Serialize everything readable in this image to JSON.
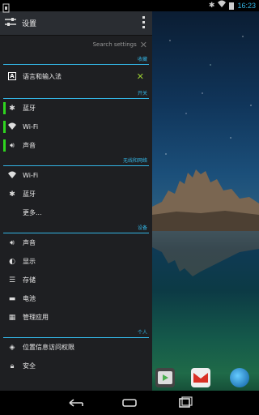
{
  "status_bar": {
    "time": "16:23",
    "icons": [
      "notification-icon",
      "bluetooth-icon",
      "wifi-icon",
      "battery-icon"
    ]
  },
  "action_bar": {
    "title": "设置",
    "icon": "settings-tune-icon",
    "overflow": "overflow-menu-icon"
  },
  "search": {
    "placeholder": "Search settings"
  },
  "sections": [
    {
      "key": "favorites",
      "header": "收藏",
      "items": [
        {
          "label": "语言和输入法",
          "icon": "keyboard-a-icon",
          "extra": "✕"
        }
      ]
    },
    {
      "key": "toggles",
      "header": "开关",
      "items": [
        {
          "label": "蓝牙",
          "icon": "bluetooth-icon",
          "selected": true
        },
        {
          "label": "Wi-Fi",
          "icon": "wifi-icon",
          "selected": true
        },
        {
          "label": "声音",
          "icon": "sound-icon",
          "selected": true
        }
      ]
    },
    {
      "key": "wireless",
      "header": "无线和网络",
      "items": [
        {
          "label": "Wi-Fi",
          "icon": "wifi-icon"
        },
        {
          "label": "蓝牙",
          "icon": "bluetooth-icon"
        },
        {
          "label": "更多..."
        }
      ]
    },
    {
      "key": "device",
      "header": "设备",
      "items": [
        {
          "label": "声音",
          "icon": "sound-icon"
        },
        {
          "label": "显示",
          "icon": "brightness-icon"
        },
        {
          "label": "存储",
          "icon": "storage-icon"
        },
        {
          "label": "电池",
          "icon": "battery-icon"
        },
        {
          "label": "管理应用",
          "icon": "apps-icon"
        }
      ]
    },
    {
      "key": "personal",
      "header": "个人",
      "items": [
        {
          "label": "位置信息访问权限",
          "icon": "location-icon"
        },
        {
          "label": "安全",
          "icon": "lock-icon"
        }
      ]
    }
  ],
  "nav": [
    "back-icon",
    "home-icon",
    "recents-icon"
  ],
  "colors": {
    "accent": "#33b5e5",
    "selected": "#2fd41f",
    "panel": "#1e1f22"
  }
}
